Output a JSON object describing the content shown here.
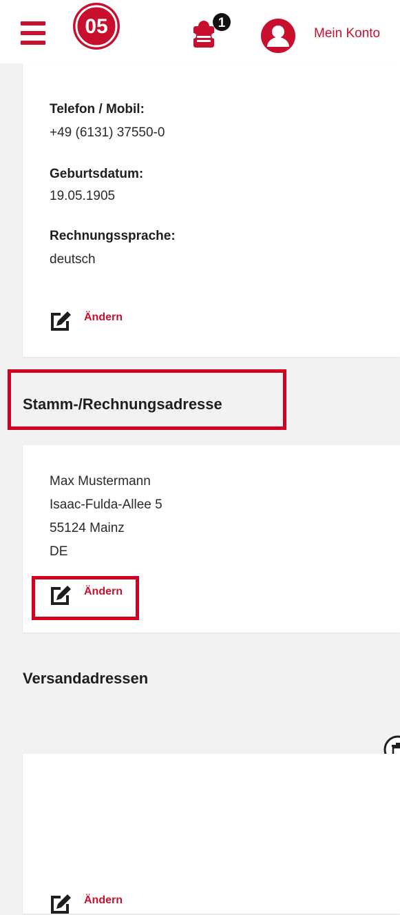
{
  "header": {
    "account_label": "Mein Konto",
    "ticket_count": "1",
    "logo_text": "05",
    "brand_color": "#c8102e"
  },
  "personal": {
    "phone_label": "Telefon / Mobil:",
    "phone_value": "+49 (6131) 37550-0",
    "birth_label": "Geburtsdatum:",
    "birth_value": "19.05.1905",
    "language_label": "Rechnungssprache:",
    "language_value": "deutsch",
    "edit_label": "Ändern"
  },
  "billing": {
    "title": "Stamm-/Rechnungsadresse",
    "name": "Max Mustermann",
    "street": "Isaac-Fulda-Allee 5",
    "city": "55124 Mainz",
    "country": "DE",
    "edit_label": "Ändern"
  },
  "shipping": {
    "title": "Versandadressen",
    "edit_label": "Ändern"
  },
  "icons": {
    "menu": "hamburger-menu-icon",
    "ticket": "ticket-cart-icon",
    "account": "user-icon",
    "edit": "edit-icon",
    "trash": "trash-icon"
  },
  "highlight_color": "#d40020"
}
